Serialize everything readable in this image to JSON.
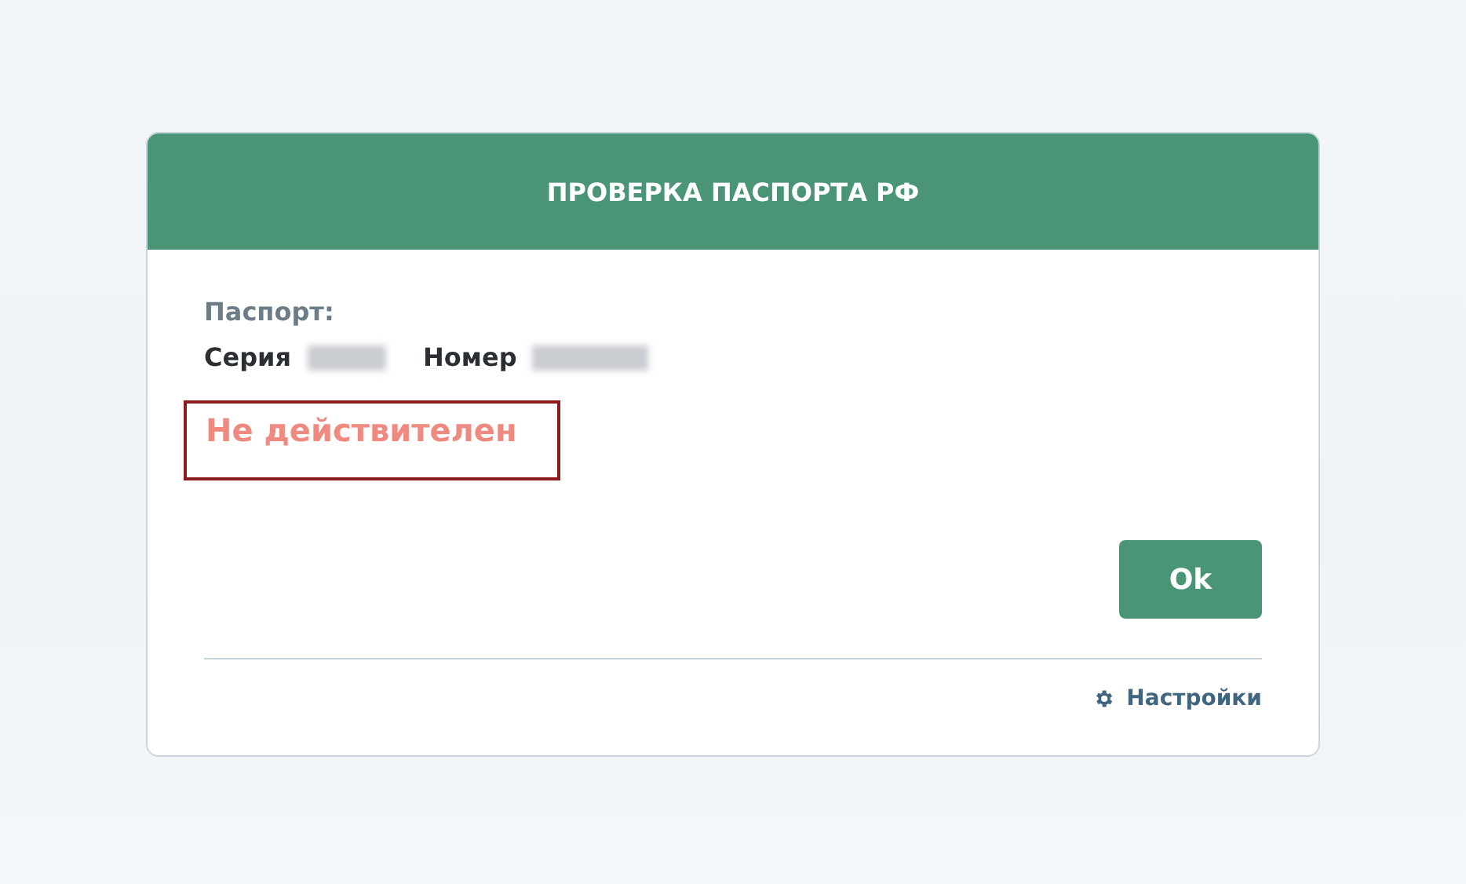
{
  "dialog": {
    "title": "ПРОВЕРКА ПАСПОРТА РФ",
    "section_label": "Паспорт:",
    "fields": [
      {
        "label": "Серия"
      },
      {
        "label": "Номер"
      }
    ],
    "status": {
      "text": "Не действителен",
      "valid": false,
      "highlighted": true
    },
    "ok_button": "Ok",
    "settings_link": "Настройки"
  }
}
